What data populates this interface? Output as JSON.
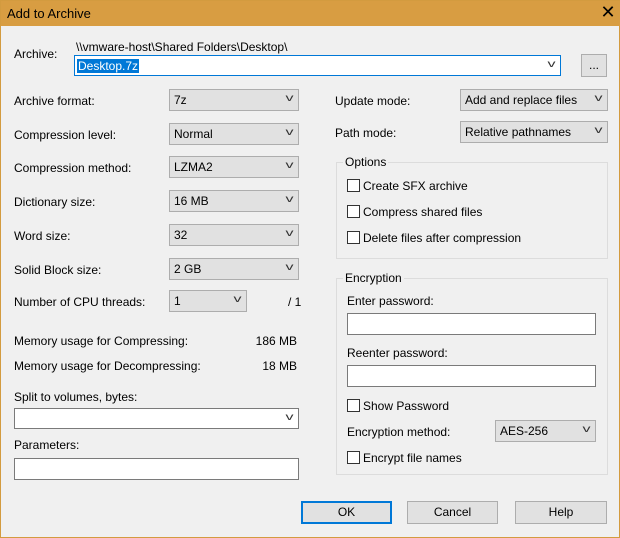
{
  "window": {
    "title": "Add to Archive",
    "close": "✕"
  },
  "archive": {
    "label": "Archive:",
    "path": "\\\\vmware-host\\Shared Folders\\Desktop\\",
    "value": "Desktop.7z",
    "browse": "..."
  },
  "left": {
    "format": {
      "label": "Archive format:",
      "value": "7z"
    },
    "level": {
      "label": "Compression level:",
      "value": "Normal"
    },
    "method": {
      "label": "Compression method:",
      "value": "LZMA2"
    },
    "dict": {
      "label": "Dictionary size:",
      "value": "16 MB"
    },
    "word": {
      "label": "Word size:",
      "value": "32"
    },
    "solid": {
      "label": "Solid Block size:",
      "value": "2 GB"
    },
    "threads": {
      "label": "Number of CPU threads:",
      "value": "1",
      "max": "/ 1"
    },
    "mem_comp": {
      "label": "Memory usage for Compressing:",
      "value": "186 MB"
    },
    "mem_decomp": {
      "label": "Memory usage for Decompressing:",
      "value": "18 MB"
    },
    "split": {
      "label": "Split to volumes, bytes:",
      "value": ""
    },
    "params": {
      "label": "Parameters:",
      "value": ""
    }
  },
  "right": {
    "update": {
      "label": "Update mode:",
      "value": "Add and replace files"
    },
    "path": {
      "label": "Path mode:",
      "value": "Relative pathnames"
    },
    "options": {
      "title": "Options",
      "items": [
        "Create SFX archive",
        "Compress shared files",
        "Delete files after compression"
      ]
    },
    "encryption": {
      "title": "Encryption",
      "enter": "Enter password:",
      "reenter": "Reenter password:",
      "show": "Show Password",
      "method_label": "Encryption method:",
      "method": "AES-256",
      "names": "Encrypt file names"
    }
  },
  "buttons": {
    "ok": "OK",
    "cancel": "Cancel",
    "help": "Help"
  },
  "icons": {
    "dropdown": "chevron-down-icon",
    "close": "close-icon"
  }
}
